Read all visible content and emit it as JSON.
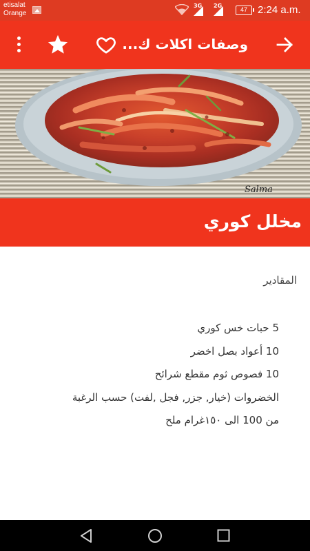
{
  "status_bar": {
    "carrier_line1": "etisalat",
    "carrier_line2": "Orange",
    "network1": "3G",
    "network2": "2G",
    "battery": "47",
    "time": "2:24 a.m."
  },
  "toolbar": {
    "title": "وصفات اكلات ك..."
  },
  "recipe": {
    "title": "مخلل كوري",
    "image_watermark": "Salma",
    "section_heading": "المقادير",
    "ingredients": [
      "5 حبات خس كوري",
      "10 أعواد بصل اخضر",
      "10 فصوص ثوم مقطع شرائح",
      "الخضروات (خيار, جزر, فجل ,لفت) حسب الرغبة",
      "من 100 الى ١٥٠غرام ملح"
    ]
  },
  "colors": {
    "status_bar": "#de3b22",
    "toolbar": "#f0341d",
    "nav_bar": "#000000"
  },
  "icons": [
    "gallery-icon",
    "wifi-icon",
    "signal-icon",
    "battery-icon",
    "more-vert-icon",
    "star-icon",
    "heart-outline-icon",
    "arrow-forward-icon",
    "nav-back-icon",
    "nav-home-icon",
    "nav-recents-icon"
  ]
}
